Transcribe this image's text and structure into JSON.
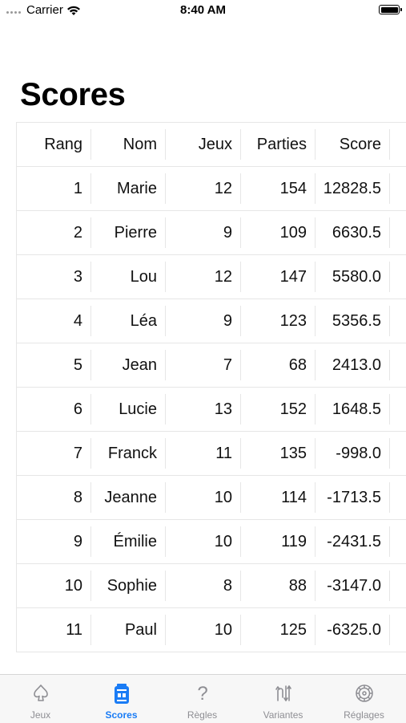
{
  "status_bar": {
    "carrier": "Carrier",
    "time": "8:40 AM"
  },
  "title": "Scores",
  "table": {
    "headers": [
      "Rang",
      "Nom",
      "Jeux",
      "Parties",
      "Score"
    ],
    "rows": [
      [
        "1",
        "Marie",
        "12",
        "154",
        "12828.5"
      ],
      [
        "2",
        "Pierre",
        "9",
        "109",
        "6630.5"
      ],
      [
        "3",
        "Lou",
        "12",
        "147",
        "5580.0"
      ],
      [
        "4",
        "Léa",
        "9",
        "123",
        "5356.5"
      ],
      [
        "5",
        "Jean",
        "7",
        "68",
        "2413.0"
      ],
      [
        "6",
        "Lucie",
        "13",
        "152",
        "1648.5"
      ],
      [
        "7",
        "Franck",
        "11",
        "135",
        "-998.0"
      ],
      [
        "8",
        "Jeanne",
        "10",
        "114",
        "-1713.5"
      ],
      [
        "9",
        "Émilie",
        "10",
        "119",
        "-2431.5"
      ],
      [
        "10",
        "Sophie",
        "8",
        "88",
        "-3147.0"
      ],
      [
        "11",
        "Paul",
        "10",
        "125",
        "-6325.0"
      ]
    ]
  },
  "tabs": [
    {
      "label": "Jeux",
      "icon": "spade-icon",
      "active": false
    },
    {
      "label": "Scores",
      "icon": "scoreboard-icon",
      "active": true
    },
    {
      "label": "Règles",
      "icon": "question-icon",
      "active": false
    },
    {
      "label": "Variantes",
      "icon": "variants-icon",
      "active": false
    },
    {
      "label": "Réglages",
      "icon": "settings-icon",
      "active": false
    }
  ],
  "colors": {
    "accent": "#1a7cf5",
    "inactive": "#8e8e93",
    "grid": "#e6e6e6"
  }
}
